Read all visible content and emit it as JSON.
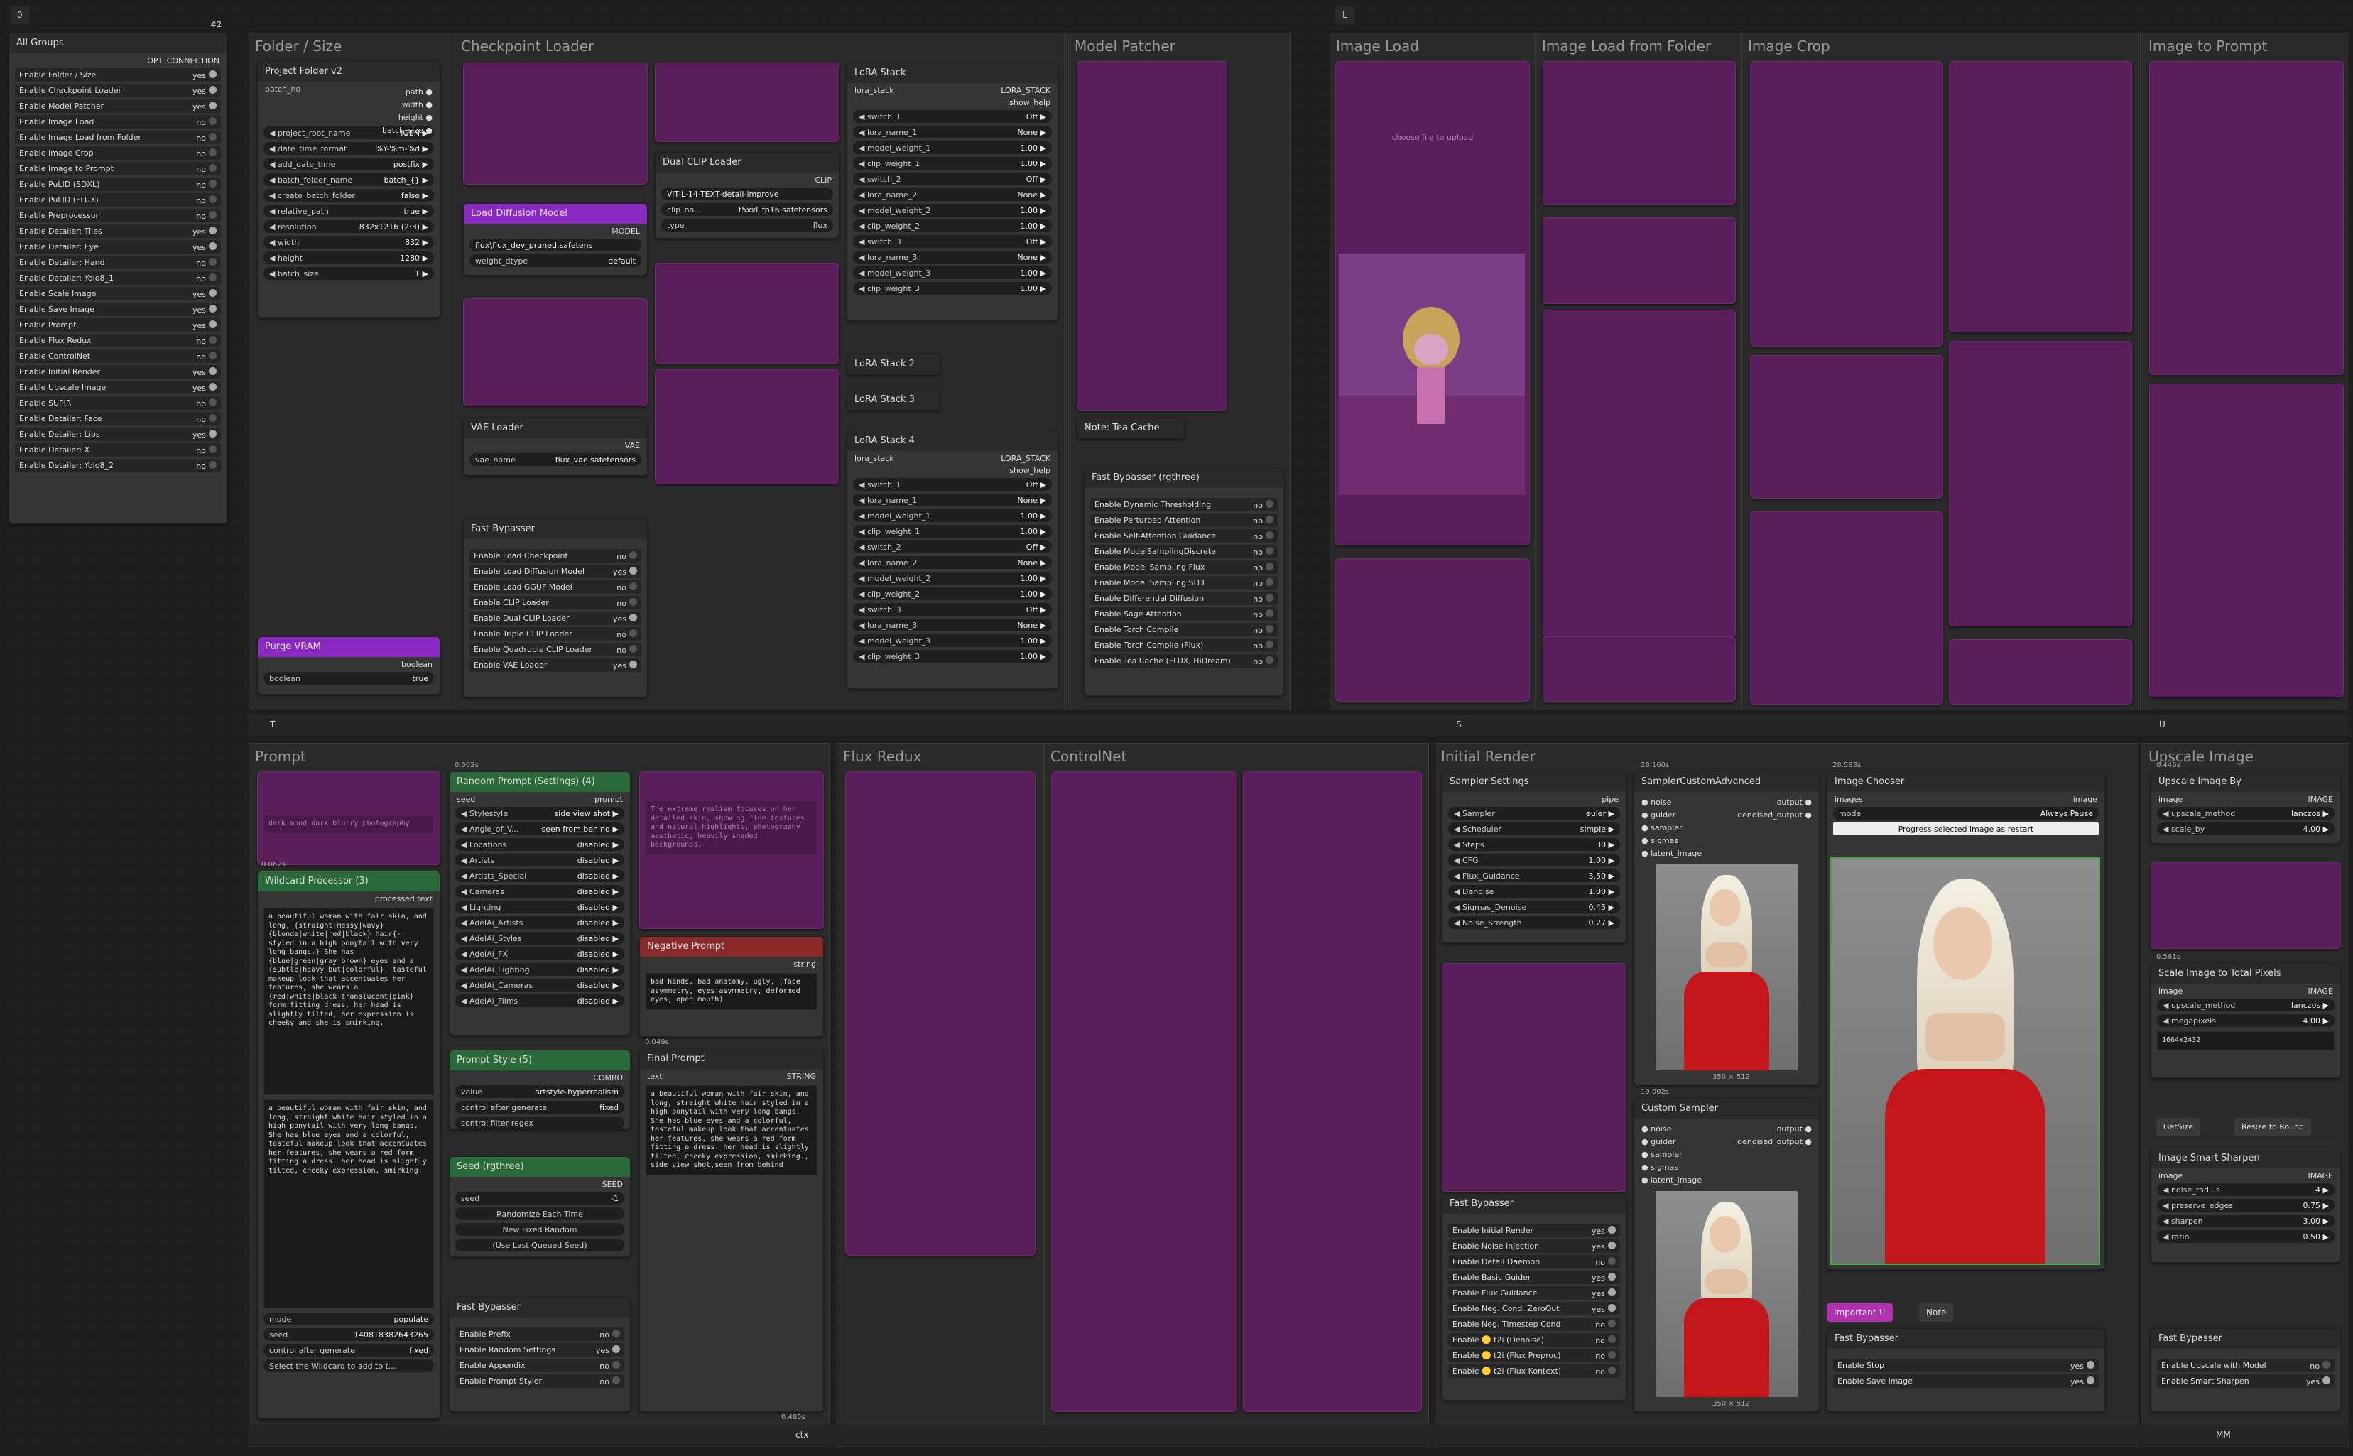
{
  "canvas": {
    "top_left_id": "0",
    "right_tag": "L",
    "corner_tag": "#2"
  },
  "groups": {
    "folder_size": "Folder / Size",
    "checkpoint_loader": "Checkpoint Loader",
    "model_patcher": "Model Patcher",
    "image_load": "Image Load",
    "image_load_folder": "Image Load from Folder",
    "image_crop": "Image Crop",
    "image_to_prompt": "Image to Prompt",
    "prompt": "Prompt",
    "flux_redux": "Flux Redux",
    "controlnet": "ControlNet",
    "initial_render": "Initial Render",
    "upscale_image": "Upscale Image"
  },
  "all_groups": {
    "title": "All Groups",
    "header": "OPT_CONNECTION",
    "items": [
      {
        "label": "Enable Folder / Size",
        "value": "yes"
      },
      {
        "label": "Enable Checkpoint Loader",
        "value": "yes"
      },
      {
        "label": "Enable Model Patcher",
        "value": "yes"
      },
      {
        "label": "Enable Image Load",
        "value": "no"
      },
      {
        "label": "Enable Image Load from Folder",
        "value": "no"
      },
      {
        "label": "Enable Image Crop",
        "value": "no"
      },
      {
        "label": "Enable Image to Prompt",
        "value": "no"
      },
      {
        "label": "Enable PuLID (SDXL)",
        "value": "no"
      },
      {
        "label": "Enable PuLID (FLUX)",
        "value": "no"
      },
      {
        "label": "Enable Preprocessor",
        "value": "no"
      },
      {
        "label": "Enable Detailer: Tiles",
        "value": "yes"
      },
      {
        "label": "Enable Detailer: Eye",
        "value": "yes"
      },
      {
        "label": "Enable Detailer: Hand",
        "value": "no"
      },
      {
        "label": "Enable Detailer: Yolo8_1",
        "value": "no"
      },
      {
        "label": "Enable Scale Image",
        "value": "yes"
      },
      {
        "label": "Enable Save Image",
        "value": "yes"
      },
      {
        "label": "Enable Prompt",
        "value": "yes"
      },
      {
        "label": "Enable Flux Redux",
        "value": "no"
      },
      {
        "label": "Enable ControlNet",
        "value": "no"
      },
      {
        "label": "Enable Initial Render",
        "value": "yes"
      },
      {
        "label": "Enable Upscale Image",
        "value": "yes"
      },
      {
        "label": "Enable SUPIR",
        "value": "no"
      },
      {
        "label": "Enable Detailer: Face",
        "value": "no"
      },
      {
        "label": "Enable Detailer: Lips",
        "value": "yes"
      },
      {
        "label": "Enable Detailer: X",
        "value": "no"
      },
      {
        "label": "Enable Detailer: Yolo8_2",
        "value": "no"
      }
    ]
  },
  "project_folder": {
    "title": "Project Folder v2",
    "id": "#3",
    "outputs": [
      "path",
      "width",
      "height",
      "batch_size"
    ],
    "input": "batch_no",
    "rows": [
      {
        "label": "project_root_name",
        "value": "IGEN"
      },
      {
        "label": "date_time_format",
        "value": "%Y-%m-%d"
      },
      {
        "label": "add_date_time",
        "value": "postfix"
      },
      {
        "label": "batch_folder_name",
        "value": "batch_{}"
      },
      {
        "label": "create_batch_folder",
        "value": "false"
      },
      {
        "label": "relative_path",
        "value": "true"
      },
      {
        "label": "resolution",
        "value": "832x1216 (2:3)"
      },
      {
        "label": "width",
        "value": "832"
      },
      {
        "label": "height",
        "value": "1280"
      },
      {
        "label": "batch_size",
        "value": "1"
      }
    ]
  },
  "purge_vram": {
    "title": "Purge VRAM",
    "id": "#4",
    "output": "boolean",
    "row_label": "boolean",
    "row_value": "true"
  },
  "load_diffusion": {
    "title": "Load Diffusion Model",
    "id": "#39",
    "output": "MODEL",
    "unet": "flux\\flux_dev_pruned.safetens",
    "dtype_label": "weight_dtype",
    "dtype": "default"
  },
  "dual_clip": {
    "title": "Dual CLIP Loader",
    "id": "#40",
    "output": "CLIP",
    "clip1": "ViT-L-14-TEXT-detail-improve",
    "clip2_label": "clip_na...",
    "clip2": "t5xxl_fp16.safetensors",
    "type_label": "type",
    "type": "flux"
  },
  "vae_loader": {
    "title": "VAE Loader",
    "id": "#38",
    "output": "VAE",
    "label": "vae_name",
    "value": "flux_vae.safetensors"
  },
  "fast_bypasser_ckpt": {
    "title": "Fast Bypasser",
    "id": "#45",
    "items": [
      {
        "label": "Enable Load Checkpoint",
        "value": "no"
      },
      {
        "label": "Enable Load Diffusion Model",
        "value": "yes"
      },
      {
        "label": "Enable Load GGUF Model",
        "value": "no"
      },
      {
        "label": "Enable CLIP Loader",
        "value": "no"
      },
      {
        "label": "Enable Dual CLIP Loader",
        "value": "yes"
      },
      {
        "label": "Enable Triple CLIP Loader",
        "value": "no"
      },
      {
        "label": "Enable Quadruple CLIP Loader",
        "value": "no"
      },
      {
        "label": "Enable VAE Loader",
        "value": "yes"
      }
    ]
  },
  "lora_stack": {
    "title": "LoRA Stack",
    "id": "#44",
    "input": "lora_stack",
    "output": "LORA_STACK",
    "show_help": "show_help",
    "rows": [
      {
        "label": "switch_1",
        "value": "Off"
      },
      {
        "label": "lora_name_1",
        "value": "None"
      },
      {
        "label": "model_weight_1",
        "value": "1.00"
      },
      {
        "label": "clip_weight_1",
        "value": "1.00"
      },
      {
        "label": "switch_2",
        "value": "Off"
      },
      {
        "label": "lora_name_2",
        "value": "None"
      },
      {
        "label": "model_weight_2",
        "value": "1.00"
      },
      {
        "label": "clip_weight_2",
        "value": "1.00"
      },
      {
        "label": "switch_3",
        "value": "Off"
      },
      {
        "label": "lora_name_3",
        "value": "None"
      },
      {
        "label": "model_weight_3",
        "value": "1.00"
      },
      {
        "label": "clip_weight_3",
        "value": "1.00"
      }
    ]
  },
  "lora_stack2": {
    "title": "LoRA Stack 2",
    "id": "#49"
  },
  "lora_stack3": {
    "title": "LoRA Stack 3",
    "id": "#19"
  },
  "lora_stack4": {
    "title": "LoRA Stack 4",
    "id": "#50",
    "input": "lora_stack",
    "output": "LORA_STACK",
    "show_help": "show_help",
    "rows": [
      {
        "label": "switch_1",
        "value": "Off"
      },
      {
        "label": "lora_name_1",
        "value": "None"
      },
      {
        "label": "model_weight_1",
        "value": "1.00"
      },
      {
        "label": "clip_weight_1",
        "value": "1.00"
      },
      {
        "label": "switch_2",
        "value": "Off"
      },
      {
        "label": "lora_name_2",
        "value": "None"
      },
      {
        "label": "model_weight_2",
        "value": "1.00"
      },
      {
        "label": "clip_weight_2",
        "value": "1.00"
      },
      {
        "label": "switch_3",
        "value": "Off"
      },
      {
        "label": "lora_name_3",
        "value": "None"
      },
      {
        "label": "model_weight_3",
        "value": "1.00"
      },
      {
        "label": "clip_weight_3",
        "value": "1.00"
      }
    ]
  },
  "tea_cache_note": {
    "title": "Note: Tea Cache"
  },
  "fast_bypasser_model": {
    "title": "Fast Bypasser (rgthree)",
    "id": "#47",
    "items": [
      {
        "label": "Enable Dynamic Thresholding",
        "value": "no"
      },
      {
        "label": "Enable Perturbed Attention",
        "value": "no"
      },
      {
        "label": "Enable Self-Attention Guidance",
        "value": "no"
      },
      {
        "label": "Enable ModelSamplingDiscrete",
        "value": "no"
      },
      {
        "label": "Enable Model Sampling Flux",
        "value": "no"
      },
      {
        "label": "Enable Model Sampling SD3",
        "value": "no"
      },
      {
        "label": "Enable Differential Diffusion",
        "value": "no"
      },
      {
        "label": "Enable Sage Attention",
        "value": "no"
      },
      {
        "label": "Enable Torch Compile",
        "value": "no"
      },
      {
        "label": "Enable Torch Compile (Flux)",
        "value": "no"
      },
      {
        "label": "Enable Tea Cache (FLUX, HiDream)",
        "value": "no"
      }
    ]
  },
  "random_prompt": {
    "title": "Random Prompt (Settings) (4)",
    "id": "#126",
    "timer": "0.002s",
    "input": "seed",
    "output": "prompt",
    "rows": [
      {
        "label": "Stylestyle",
        "value": "side view shot"
      },
      {
        "label": "Angle_of_V...",
        "value": "seen from behind"
      },
      {
        "label": "Locations",
        "value": "disabled"
      },
      {
        "label": "Artists",
        "value": "disabled"
      },
      {
        "label": "Artists_Special",
        "value": "disabled"
      },
      {
        "label": "Cameras",
        "value": "disabled"
      },
      {
        "label": "Lighting",
        "value": "disabled"
      },
      {
        "label": "AdelAi_Artists",
        "value": "disabled"
      },
      {
        "label": "AdelAi_Styles",
        "value": "disabled"
      },
      {
        "label": "AdelAi_FX",
        "value": "disabled"
      },
      {
        "label": "AdelAi_Lighting",
        "value": "disabled"
      },
      {
        "label": "AdelAi_Cameras",
        "value": "disabled"
      },
      {
        "label": "AdelAi_Films",
        "value": "disabled"
      }
    ]
  },
  "prompt_style": {
    "title": "Prompt Style (5)",
    "id": "#128",
    "output": "COMBO",
    "value_label": "value",
    "value": "artstyle-hyperrealism",
    "control_label": "control after generate",
    "control": "fixed",
    "filter_label": "control filter regex"
  },
  "seed_node": {
    "title": "Seed (rgthree)",
    "id": "#118",
    "output": "SEED",
    "label": "seed",
    "value": "-1",
    "btn1": "Randomize Each Time",
    "btn2": "New Fixed Random",
    "btn3": "(Use Last Queued Seed)"
  },
  "fast_bypasser_prompt": {
    "title": "Fast Bypasser",
    "items": [
      {
        "label": "Enable Prefix",
        "value": "no"
      },
      {
        "label": "Enable Random Settings",
        "value": "yes"
      },
      {
        "label": "Enable Appendix",
        "value": "no"
      },
      {
        "label": "Enable Prompt Styler",
        "value": "no"
      }
    ]
  },
  "prefix_text": "dark mood dark blurry photography",
  "wildcard": {
    "title": "Wildcard Processor (3)",
    "id": "#127",
    "timer": "0.062s",
    "output": "processed text",
    "text1": "a beautiful woman with fair skin, and long, {straight|messy|wavy} {blonde|white|red|black} hair{-| styled in a high ponytail with very long bangs.} She has {blue|green|gray|brown} eyes and a {subtle|heavy but|colorful}, tasteful makeup look that accentuates her features, she wears a {red|white|black|translucent|pink} form fitting dress. her head is slightly tilted, her expression is cheeky and she is smirking.",
    "text2": "a beautiful woman with fair skin, and long, straight white hair styled in a high ponytail with very long bangs. She has blue eyes and a colorful, tasteful makeup look that accentuates her features, she wears a red form fitting a dress. her head is slightly tilted, cheeky expression, smirking.",
    "mode_label": "mode",
    "mode": "populate",
    "seed_label": "seed",
    "seed": "140818382643265",
    "control_label": "control after generate",
    "control": "fixed",
    "select": "Select the Wildcard to add to t..."
  },
  "negative_prompt": {
    "title": "Negative Prompt",
    "id": "#121",
    "output": "string",
    "text": "bad hands, bad anatomy, ugly, (face asymmetry, eyes asymmetry, deformed eyes, open mouth)",
    "timer": "0.049s"
  },
  "final_prompt": {
    "title": "Final Prompt",
    "input": "text",
    "output": "STRING",
    "text": "a beautiful woman with fair skin, and long, straight white hair styled in a high ponytail with very long bangs. She has blue eyes and a colorful, tasteful makeup look that accentuates her features, she wears a red form fitting a dress. her head is slightly tilted, cheeky expression, smirking., side view shot,seen from behind",
    "timer": "0.485s",
    "id": "23"
  },
  "appendix_text": "The extreme realism focuses on her detailed skin, showing fine textures and natural highlights, photography aesthetic, heavily shaded backgrounds.",
  "sampler_settings": {
    "title": "Sampler Settings",
    "id": "#202",
    "output": "pipe",
    "rows": [
      {
        "label": "Sampler",
        "value": "euler"
      },
      {
        "label": "Scheduler",
        "value": "simple"
      },
      {
        "label": "Steps",
        "value": "30"
      },
      {
        "label": "CFG",
        "value": "1.00"
      },
      {
        "label": "Flux_Guidance",
        "value": "3.50"
      },
      {
        "label": "Denoise",
        "value": "1.00"
      },
      {
        "label": "Sigmas_Denoise",
        "value": "0.45"
      },
      {
        "label": "Noise_Strength",
        "value": "0.27"
      }
    ]
  },
  "sampler_custom": {
    "title": "SamplerCustomAdvanced",
    "id": "#213",
    "timer": "28.160s",
    "inputs": [
      "noise",
      "guider",
      "sampler",
      "sigmas",
      "latent_image"
    ],
    "outputs": [
      "output",
      "denoised_output"
    ],
    "caption": "350 × 512"
  },
  "custom_sampler": {
    "title": "Custom Sampler",
    "id": "#214",
    "timer": "19.002s",
    "inputs": [
      "noise",
      "guider",
      "sampler",
      "sigmas",
      "latent_image"
    ],
    "outputs": [
      "output",
      "denoised_output"
    ],
    "caption": "350 × 512"
  },
  "fast_bypasser_render": {
    "title": "Fast Bypasser",
    "id": "#215",
    "items": [
      {
        "label": "Enable Initial Render",
        "value": "yes"
      },
      {
        "label": "Enable Noise Injection",
        "value": "yes"
      },
      {
        "label": "Enable Detail Daemon",
        "value": "no"
      },
      {
        "label": "Enable Basic Guider",
        "value": "yes"
      },
      {
        "label": "Enable Flux Guidance",
        "value": "yes"
      },
      {
        "label": "Enable Neg. Cond. ZeroOut",
        "value": "yes"
      },
      {
        "label": "Enable Neg. Timestep Cond",
        "value": "no"
      },
      {
        "label": "Enable 🟡 t2i (Denoise)",
        "value": "no"
      },
      {
        "label": "Enable 🟡 t2i (Flux Preproc)",
        "value": "no"
      },
      {
        "label": "Enable 🟡 t2i (Flux Kontext)",
        "value": "no"
      }
    ]
  },
  "image_chooser": {
    "title": "Image Chooser",
    "id": "#204",
    "timer": "28.583s",
    "input": "images",
    "output": "image",
    "mode_label": "mode",
    "mode": "Always Pause",
    "button": "Progress selected image as restart"
  },
  "important": {
    "btn1": "Important !!",
    "btn2": "Note"
  },
  "fast_bypasser_save": {
    "title": "Fast Bypasser",
    "id": "#216",
    "items": [
      {
        "label": "Enable Stop",
        "value": "yes"
      },
      {
        "label": "Enable Save Image",
        "value": "yes"
      }
    ]
  },
  "upscale_by": {
    "title": "Upscale Image By",
    "id": "#218",
    "timer": "0.446s",
    "input": "image",
    "output": "IMAGE",
    "rows": [
      {
        "label": "upscale_method",
        "value": "lanczos"
      },
      {
        "label": "scale_by",
        "value": "4.00"
      }
    ]
  },
  "scale_total": {
    "title": "Scale Image to Total Pixels",
    "id": "#226",
    "timer": "0.561s",
    "input": "image",
    "output": "IMAGE",
    "rows": [
      {
        "label": "upscale_method",
        "value": "lanczos"
      },
      {
        "label": "megapixels",
        "value": "4.00"
      }
    ],
    "readout": "1664x2432"
  },
  "smart_sharpen": {
    "title": "Image Smart Sharpen",
    "id": "#233",
    "input": "image",
    "output": "IMAGE",
    "rows": [
      {
        "label": "noise_radius",
        "value": "4"
      },
      {
        "label": "preserve_edges",
        "value": "0.75"
      },
      {
        "label": "sharpen",
        "value": "3.00"
      },
      {
        "label": "ratio",
        "value": "0.50"
      }
    ]
  },
  "getsize": {
    "label": "GetSize",
    "id": "#219",
    "resize": "Resize to Round"
  },
  "fast_bypasser_upscale": {
    "title": "Fast Bypasser",
    "id": "#235",
    "items": [
      {
        "label": "Enable Upscale with Model",
        "value": "no"
      },
      {
        "label": "Enable Smart Sharpen",
        "value": "yes"
      }
    ]
  },
  "bottom_bars": {
    "t": "T",
    "s": "S",
    "u": "U",
    "ctx": "ctx",
    "mm": "MM"
  },
  "image_load_caption": "choose file to upload"
}
